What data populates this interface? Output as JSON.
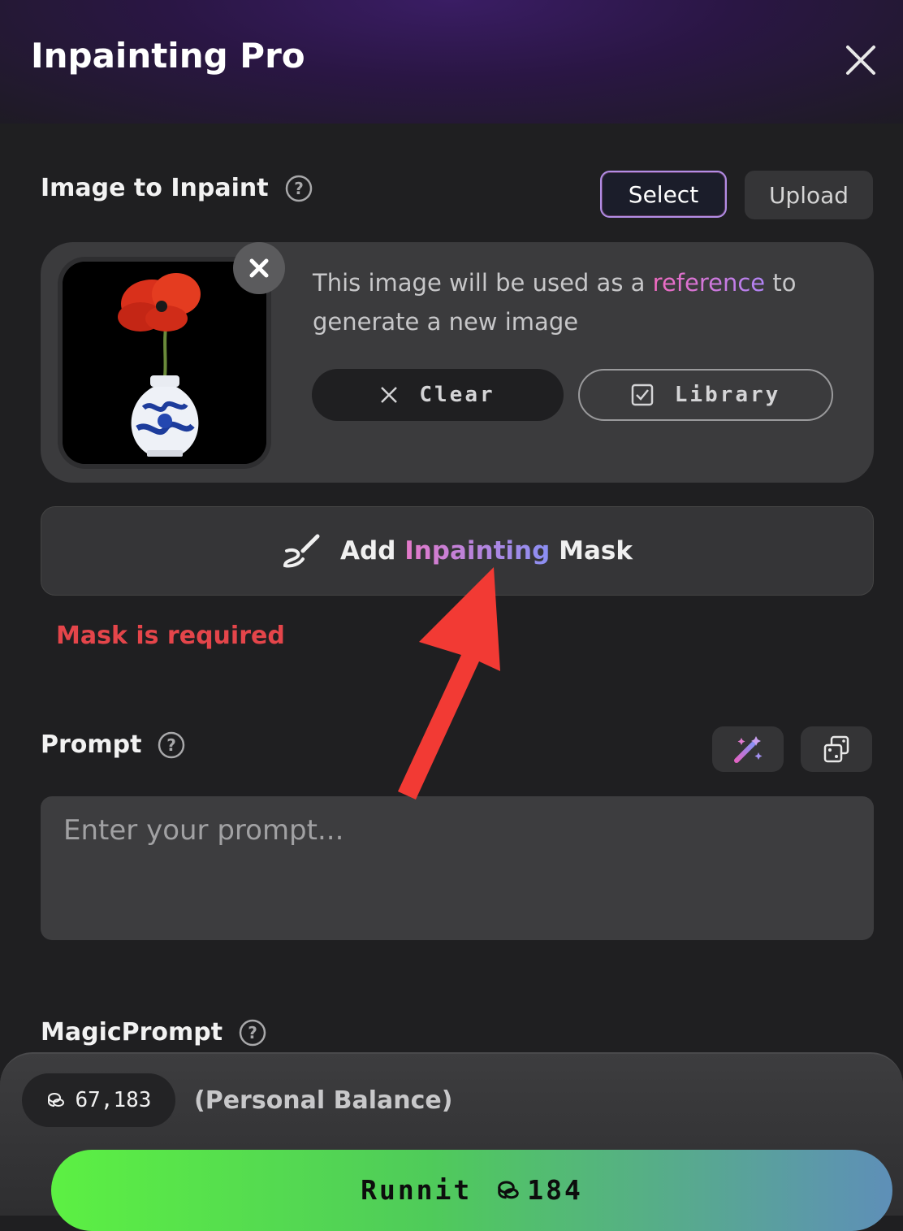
{
  "header": {
    "title": "Inpainting Pro"
  },
  "image_section": {
    "label": "Image to Inpaint",
    "select_label": "Select",
    "upload_label": "Upload",
    "reference_text_before": "This image will be used as a",
    "reference_text_highlight": "reference",
    "reference_text_after": "to generate a new image",
    "clear_label": "Clear",
    "library_label": "Library"
  },
  "mask": {
    "button_prefix": "Add",
    "button_highlight": "Inpainting",
    "button_suffix": "Mask",
    "error": "Mask is required"
  },
  "prompt": {
    "label": "Prompt",
    "placeholder": "Enter your prompt..."
  },
  "magic_prompt": {
    "label": "MagicPrompt"
  },
  "footer": {
    "balance": "67,183",
    "balance_label": "(Personal Balance)",
    "run_label": "Runnit",
    "run_cost": "184"
  },
  "colors": {
    "error": "#e4454a",
    "select_border": "#b28de6",
    "run_gradient_start": "#5cf043",
    "run_gradient_end": "#5e8fb8",
    "annotation_arrow": "#f23a34"
  },
  "icons": [
    "close-icon",
    "help-icon",
    "remove-image-icon",
    "x-icon",
    "checkbox-icon",
    "brush-icon",
    "magic-wand-icon",
    "dice-icon",
    "coin-icon"
  ]
}
